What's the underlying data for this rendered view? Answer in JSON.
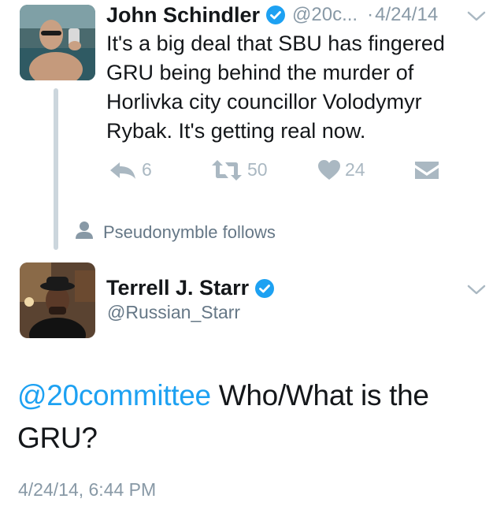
{
  "colors": {
    "link": "#1da1f2",
    "muted": "#8899a6",
    "action": "#aab8c2",
    "verified": "#1da1f2",
    "thread_line": "#ccd6dd"
  },
  "tweet1": {
    "author_name": "John Schindler",
    "handle": "@20c...",
    "separator": "·",
    "date": "4/24/14",
    "text": "It's a big deal that SBU has fingered GRU being behind the murder of Horlivka city councillor Volodymyr Rybak. It's getting real now.",
    "reply_count": "6",
    "retweet_count": "50",
    "like_count": "24",
    "icons": [
      "verified-icon",
      "chevron-down-icon",
      "reply-icon",
      "retweet-icon",
      "heart-icon",
      "direct-message-icon"
    ]
  },
  "social_context": {
    "text": "Pseudonymble follows",
    "icon": "person-icon"
  },
  "tweet2": {
    "author_name": "Terrell J. Starr",
    "handle": "@Russian_Starr",
    "mention": "@20committee",
    "text": " Who/What is the GRU?",
    "timestamp": "4/24/14, 6:44 PM",
    "icons": [
      "verified-icon",
      "chevron-down-icon"
    ]
  }
}
